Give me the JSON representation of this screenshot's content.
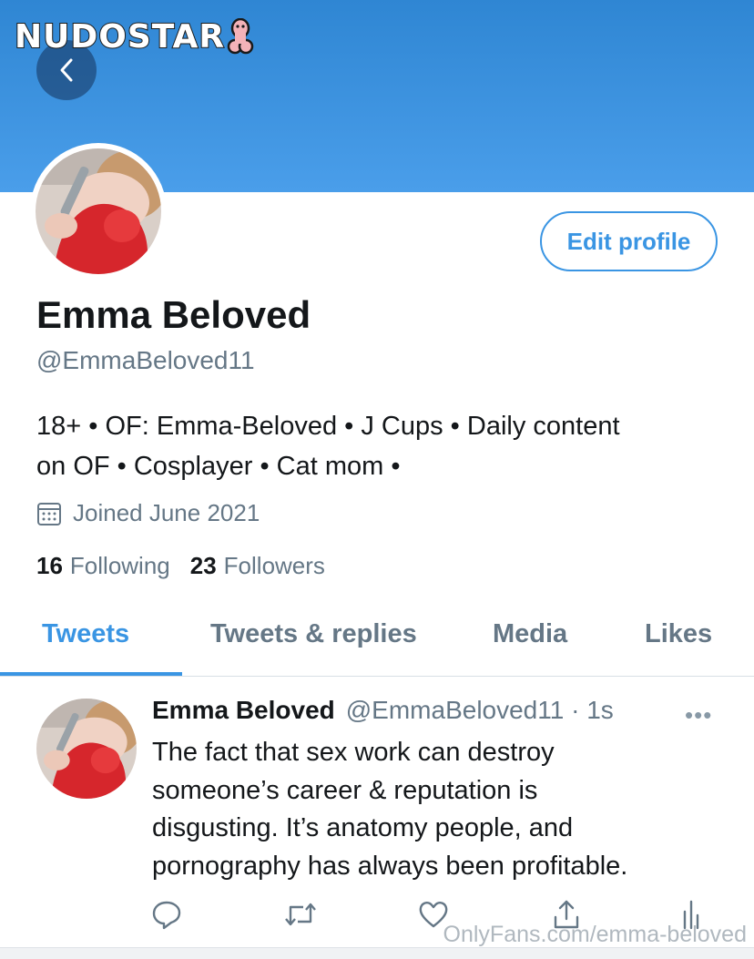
{
  "watermark": {
    "logo_text": "NUDOSTAR",
    "footer_text": "OnlyFans.com/emma-beloved"
  },
  "header": {
    "back_icon": "chevron-left-icon"
  },
  "profile": {
    "edit_button_label": "Edit profile",
    "name": "Emma Beloved",
    "handle": "@EmmaBeloved11",
    "bio_line1": "18+ • OF: Emma-Beloved • J Cups • Daily content",
    "bio_line2": "on OF • Cosplayer • Cat mom •",
    "joined": "Joined June 2021",
    "following_count": "16",
    "following_label": "Following",
    "followers_count": "23",
    "followers_label": "Followers"
  },
  "tabs": [
    {
      "label": "Tweets",
      "active": true
    },
    {
      "label": "Tweets & replies",
      "active": false
    },
    {
      "label": "Media",
      "active": false
    },
    {
      "label": "Likes",
      "active": false
    }
  ],
  "tweet": {
    "name": "Emma Beloved",
    "handle_time": "@EmmaBeloved11 · 1s",
    "more": "•••",
    "lines": [
      "The fact that sex work can destroy",
      "someone’s career & reputation is",
      "disgusting. It’s anatomy people, and",
      "pornography has always been profitable."
    ]
  },
  "actions": [
    "reply-icon",
    "retweet-icon",
    "like-icon",
    "share-icon",
    "analytics-icon"
  ],
  "colors": {
    "accent": "#3a95e3",
    "banner": "#4a9eea",
    "secondary_text": "#657786"
  }
}
